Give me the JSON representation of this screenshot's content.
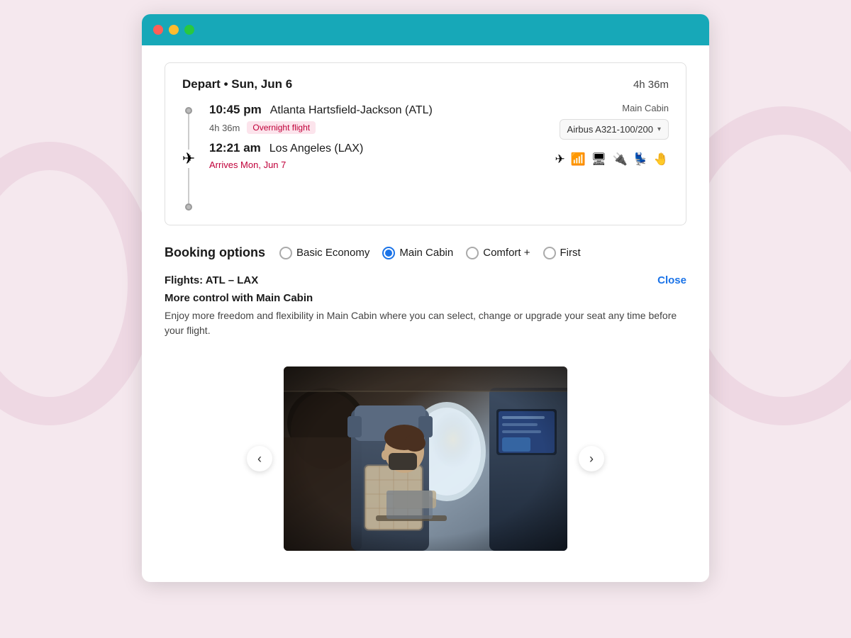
{
  "titlebar": {
    "dots": [
      "red",
      "yellow",
      "green"
    ]
  },
  "flight_card": {
    "depart_label": "Depart • Sun, Jun 6",
    "duration": "4h 36m",
    "cabin_class": "Main Cabin",
    "departure": {
      "time": "10:45 pm",
      "airport": "Atlanta Hartsfield-Jackson (ATL)"
    },
    "flight_mid": {
      "duration": "4h 36m",
      "overnight_badge": "Overnight flight"
    },
    "arrival": {
      "time": "12:21 am",
      "airport": "Los Angeles (LAX)",
      "arrives_note": "Arrives Mon, Jun 7"
    },
    "aircraft": {
      "name": "Airbus A321-100/200",
      "amenities": [
        "✈",
        "📶",
        "🖥",
        "🔌",
        "💺",
        "🤚"
      ]
    }
  },
  "booking_options": {
    "title": "Booking options",
    "options": [
      {
        "id": "basic-economy",
        "label": "Basic Economy",
        "selected": false
      },
      {
        "id": "main-cabin",
        "label": "Main Cabin",
        "selected": true
      },
      {
        "id": "comfort-plus",
        "label": "Comfort +",
        "selected": false
      },
      {
        "id": "first",
        "label": "First",
        "selected": false
      }
    ]
  },
  "info_panel": {
    "route": "Flights: ATL – LAX",
    "close_label": "Close",
    "subtitle": "More control with Main Cabin",
    "description": "Enjoy more freedom and flexibility in Main Cabin where you can select, change or upgrade your seat any time before your flight."
  },
  "carousel": {
    "prev_label": "‹",
    "next_label": "›"
  }
}
